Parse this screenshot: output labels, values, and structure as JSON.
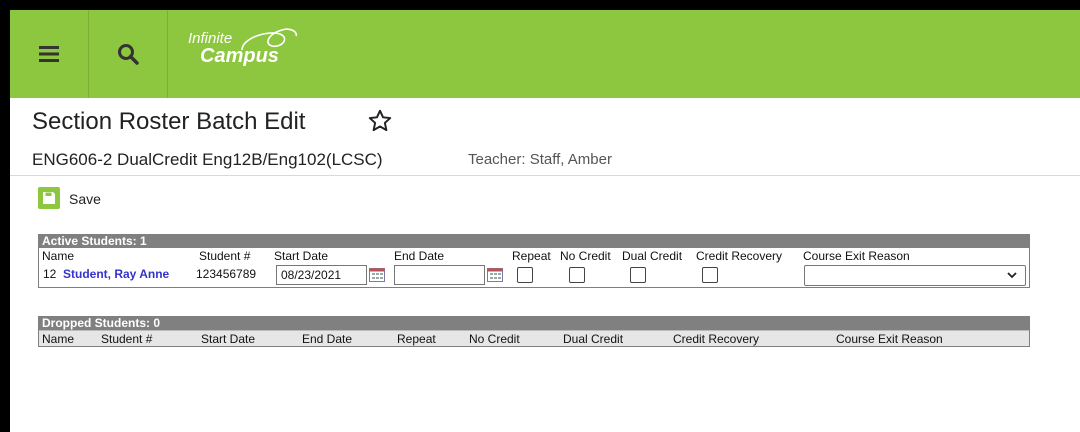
{
  "header": {
    "menu_icon": "hamburger-menu-icon",
    "search_icon": "search-icon",
    "logo_line1": "Infinite",
    "logo_line2": "Campus",
    "brand_color": "#8dc63f"
  },
  "page": {
    "title": "Section Roster Batch Edit",
    "favorite_icon": "star-outline-icon",
    "section_name": "ENG606-2 DualCredit Eng12B/Eng102(LCSC)",
    "teacher": "Teacher: Staff, Amber"
  },
  "toolbar": {
    "save_icon": "save-icon",
    "save_label": "Save"
  },
  "active": {
    "heading": "Active Students: 1",
    "columns": [
      "Name",
      "Student #",
      "Start Date",
      "End Date",
      "Repeat",
      "No Credit",
      "Dual Credit",
      "Credit Recovery",
      "Course Exit Reason"
    ],
    "rows": [
      {
        "grade": "12",
        "name": "Student, Ray Anne",
        "student_number": "123456789",
        "start_date": "08/23/2021",
        "end_date": "",
        "repeat": false,
        "no_credit": false,
        "dual_credit": false,
        "credit_recovery": false,
        "course_exit_reason": ""
      }
    ]
  },
  "dropped": {
    "heading": "Dropped Students: 0",
    "columns": [
      "Name",
      "Student #",
      "Start Date",
      "End Date",
      "Repeat",
      "No Credit",
      "Dual Credit",
      "Credit Recovery",
      "Course Exit Reason"
    ]
  }
}
